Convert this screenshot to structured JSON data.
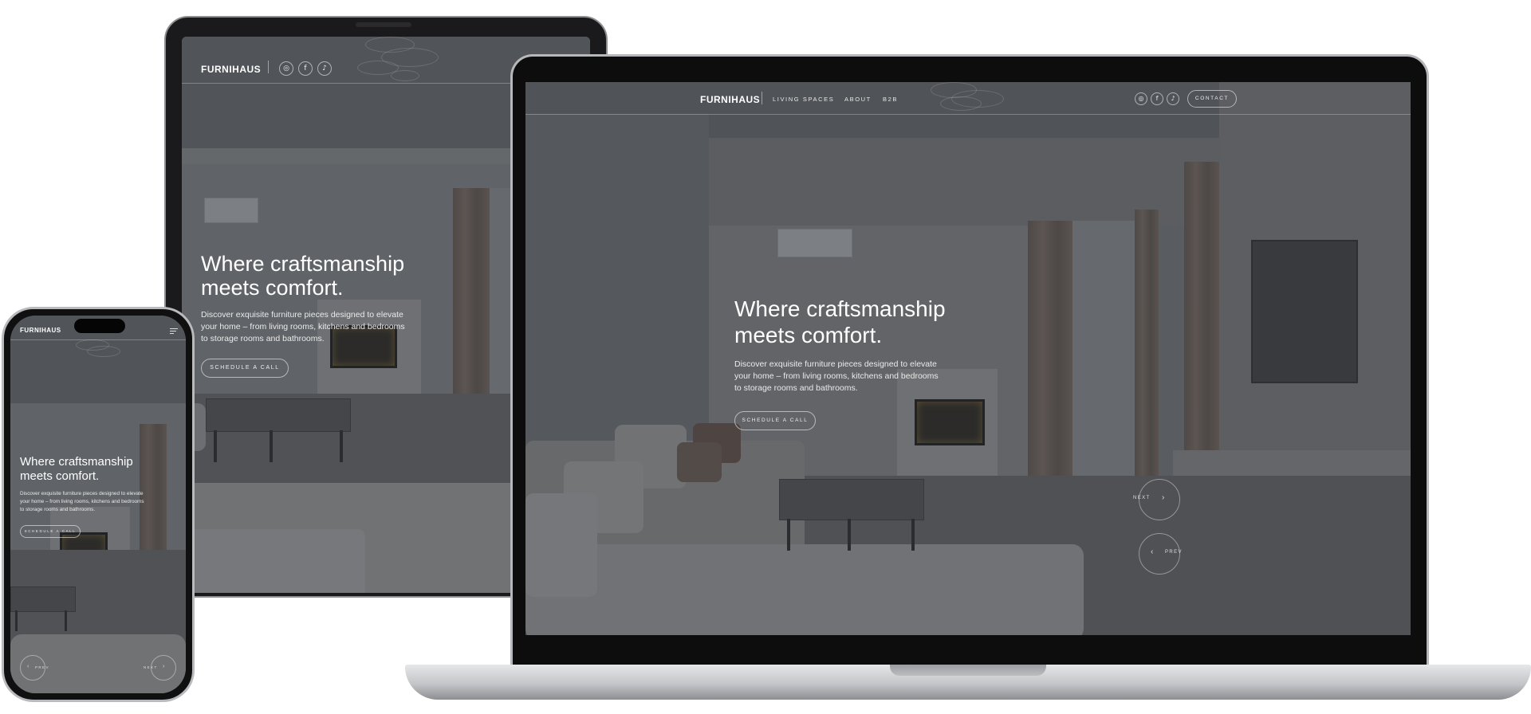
{
  "brand": "FURNIHAUS",
  "nav": {
    "items": [
      "LIVING SPACES",
      "ABOUT",
      "B2B"
    ],
    "contact_label": "CONTACT"
  },
  "social": [
    {
      "icon": "instagram-icon",
      "glyph": "◎"
    },
    {
      "icon": "facebook-icon",
      "glyph": "f"
    },
    {
      "icon": "tiktok-icon",
      "glyph": "♪"
    }
  ],
  "hero": {
    "title_line1": "Where craftsmanship",
    "title_line2": "meets comfort.",
    "desc_line1": "Discover exquisite furniture pieces designed to elevate",
    "desc_line2": "your home – from living rooms, kitchens and bedrooms",
    "desc_line3": "to storage rooms and bathrooms.",
    "cta_label": "SCHEDULE A CALL"
  },
  "slider": {
    "next_label": "NEXT",
    "prev_label": "PREV",
    "next_arrow": "›",
    "prev_arrow": "‹"
  },
  "colors": {
    "overlay": "#2d3034",
    "text": "#ffffff",
    "device_frame": "#1c1c1e",
    "laptop_body": "#c9cacc"
  }
}
